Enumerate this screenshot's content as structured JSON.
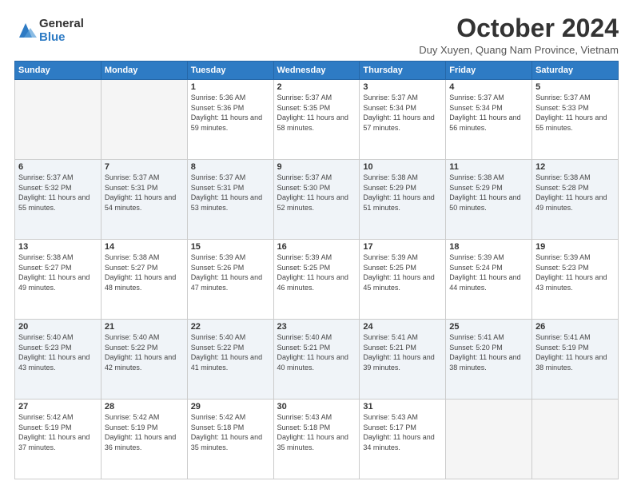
{
  "logo": {
    "general": "General",
    "blue": "Blue"
  },
  "header": {
    "month": "October 2024",
    "location": "Duy Xuyen, Quang Nam Province, Vietnam"
  },
  "weekdays": [
    "Sunday",
    "Monday",
    "Tuesday",
    "Wednesday",
    "Thursday",
    "Friday",
    "Saturday"
  ],
  "weeks": [
    [
      {
        "day": "",
        "empty": true
      },
      {
        "day": "",
        "empty": true
      },
      {
        "day": "1",
        "sunrise": "Sunrise: 5:36 AM",
        "sunset": "Sunset: 5:36 PM",
        "daylight": "Daylight: 11 hours and 59 minutes."
      },
      {
        "day": "2",
        "sunrise": "Sunrise: 5:37 AM",
        "sunset": "Sunset: 5:35 PM",
        "daylight": "Daylight: 11 hours and 58 minutes."
      },
      {
        "day": "3",
        "sunrise": "Sunrise: 5:37 AM",
        "sunset": "Sunset: 5:34 PM",
        "daylight": "Daylight: 11 hours and 57 minutes."
      },
      {
        "day": "4",
        "sunrise": "Sunrise: 5:37 AM",
        "sunset": "Sunset: 5:34 PM",
        "daylight": "Daylight: 11 hours and 56 minutes."
      },
      {
        "day": "5",
        "sunrise": "Sunrise: 5:37 AM",
        "sunset": "Sunset: 5:33 PM",
        "daylight": "Daylight: 11 hours and 55 minutes."
      }
    ],
    [
      {
        "day": "6",
        "sunrise": "Sunrise: 5:37 AM",
        "sunset": "Sunset: 5:32 PM",
        "daylight": "Daylight: 11 hours and 55 minutes."
      },
      {
        "day": "7",
        "sunrise": "Sunrise: 5:37 AM",
        "sunset": "Sunset: 5:31 PM",
        "daylight": "Daylight: 11 hours and 54 minutes."
      },
      {
        "day": "8",
        "sunrise": "Sunrise: 5:37 AM",
        "sunset": "Sunset: 5:31 PM",
        "daylight": "Daylight: 11 hours and 53 minutes."
      },
      {
        "day": "9",
        "sunrise": "Sunrise: 5:37 AM",
        "sunset": "Sunset: 5:30 PM",
        "daylight": "Daylight: 11 hours and 52 minutes."
      },
      {
        "day": "10",
        "sunrise": "Sunrise: 5:38 AM",
        "sunset": "Sunset: 5:29 PM",
        "daylight": "Daylight: 11 hours and 51 minutes."
      },
      {
        "day": "11",
        "sunrise": "Sunrise: 5:38 AM",
        "sunset": "Sunset: 5:29 PM",
        "daylight": "Daylight: 11 hours and 50 minutes."
      },
      {
        "day": "12",
        "sunrise": "Sunrise: 5:38 AM",
        "sunset": "Sunset: 5:28 PM",
        "daylight": "Daylight: 11 hours and 49 minutes."
      }
    ],
    [
      {
        "day": "13",
        "sunrise": "Sunrise: 5:38 AM",
        "sunset": "Sunset: 5:27 PM",
        "daylight": "Daylight: 11 hours and 49 minutes."
      },
      {
        "day": "14",
        "sunrise": "Sunrise: 5:38 AM",
        "sunset": "Sunset: 5:27 PM",
        "daylight": "Daylight: 11 hours and 48 minutes."
      },
      {
        "day": "15",
        "sunrise": "Sunrise: 5:39 AM",
        "sunset": "Sunset: 5:26 PM",
        "daylight": "Daylight: 11 hours and 47 minutes."
      },
      {
        "day": "16",
        "sunrise": "Sunrise: 5:39 AM",
        "sunset": "Sunset: 5:25 PM",
        "daylight": "Daylight: 11 hours and 46 minutes."
      },
      {
        "day": "17",
        "sunrise": "Sunrise: 5:39 AM",
        "sunset": "Sunset: 5:25 PM",
        "daylight": "Daylight: 11 hours and 45 minutes."
      },
      {
        "day": "18",
        "sunrise": "Sunrise: 5:39 AM",
        "sunset": "Sunset: 5:24 PM",
        "daylight": "Daylight: 11 hours and 44 minutes."
      },
      {
        "day": "19",
        "sunrise": "Sunrise: 5:39 AM",
        "sunset": "Sunset: 5:23 PM",
        "daylight": "Daylight: 11 hours and 43 minutes."
      }
    ],
    [
      {
        "day": "20",
        "sunrise": "Sunrise: 5:40 AM",
        "sunset": "Sunset: 5:23 PM",
        "daylight": "Daylight: 11 hours and 43 minutes."
      },
      {
        "day": "21",
        "sunrise": "Sunrise: 5:40 AM",
        "sunset": "Sunset: 5:22 PM",
        "daylight": "Daylight: 11 hours and 42 minutes."
      },
      {
        "day": "22",
        "sunrise": "Sunrise: 5:40 AM",
        "sunset": "Sunset: 5:22 PM",
        "daylight": "Daylight: 11 hours and 41 minutes."
      },
      {
        "day": "23",
        "sunrise": "Sunrise: 5:40 AM",
        "sunset": "Sunset: 5:21 PM",
        "daylight": "Daylight: 11 hours and 40 minutes."
      },
      {
        "day": "24",
        "sunrise": "Sunrise: 5:41 AM",
        "sunset": "Sunset: 5:21 PM",
        "daylight": "Daylight: 11 hours and 39 minutes."
      },
      {
        "day": "25",
        "sunrise": "Sunrise: 5:41 AM",
        "sunset": "Sunset: 5:20 PM",
        "daylight": "Daylight: 11 hours and 38 minutes."
      },
      {
        "day": "26",
        "sunrise": "Sunrise: 5:41 AM",
        "sunset": "Sunset: 5:19 PM",
        "daylight": "Daylight: 11 hours and 38 minutes."
      }
    ],
    [
      {
        "day": "27",
        "sunrise": "Sunrise: 5:42 AM",
        "sunset": "Sunset: 5:19 PM",
        "daylight": "Daylight: 11 hours and 37 minutes."
      },
      {
        "day": "28",
        "sunrise": "Sunrise: 5:42 AM",
        "sunset": "Sunset: 5:19 PM",
        "daylight": "Daylight: 11 hours and 36 minutes."
      },
      {
        "day": "29",
        "sunrise": "Sunrise: 5:42 AM",
        "sunset": "Sunset: 5:18 PM",
        "daylight": "Daylight: 11 hours and 35 minutes."
      },
      {
        "day": "30",
        "sunrise": "Sunrise: 5:43 AM",
        "sunset": "Sunset: 5:18 PM",
        "daylight": "Daylight: 11 hours and 35 minutes."
      },
      {
        "day": "31",
        "sunrise": "Sunrise: 5:43 AM",
        "sunset": "Sunset: 5:17 PM",
        "daylight": "Daylight: 11 hours and 34 minutes."
      },
      {
        "day": "",
        "empty": true
      },
      {
        "day": "",
        "empty": true
      }
    ]
  ]
}
